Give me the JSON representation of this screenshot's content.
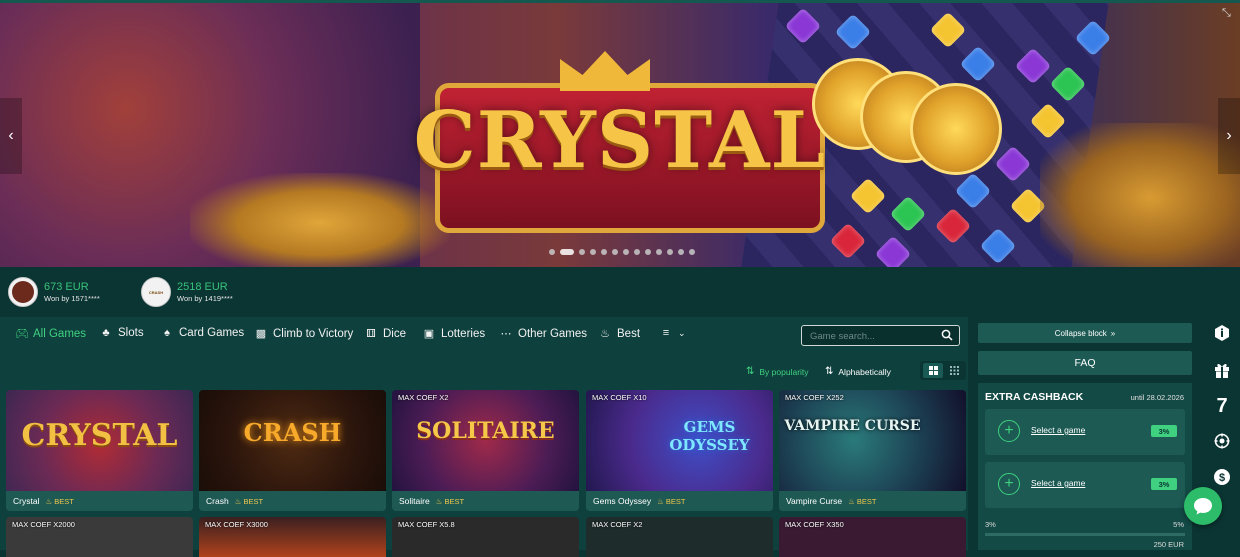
{
  "banner": {
    "title": "CRYSTAL",
    "slides_total": 13,
    "active_slide": 2
  },
  "winners": [
    {
      "amount": "673 EUR",
      "by": "Won by 1571****"
    },
    {
      "amount": "2518 EUR",
      "by": "Won by 1419****",
      "avatar_text": "CRASH"
    }
  ],
  "tabs": [
    {
      "label": "All Games",
      "icon": "gamepad-icon"
    },
    {
      "label": "Slots",
      "icon": "cherries-icon"
    },
    {
      "label": "Card Games",
      "icon": "spade-icon"
    },
    {
      "label": "Climb to Victory",
      "icon": "bars-icon"
    },
    {
      "label": "Dice",
      "icon": "dice-icon"
    },
    {
      "label": "Lotteries",
      "icon": "ticket-icon"
    },
    {
      "label": "Other Games",
      "icon": "dots-icon"
    },
    {
      "label": "Best",
      "icon": "flame-icon"
    }
  ],
  "search": {
    "placeholder": "Game search..."
  },
  "sort": {
    "popularity": "By popularity",
    "alphabetical": "Alphabetically"
  },
  "games": [
    {
      "name": "Crystal",
      "badge": "BEST",
      "coef": "",
      "logo": "CRYSTAL"
    },
    {
      "name": "Crash",
      "badge": "BEST",
      "coef": "",
      "logo": "CRASH"
    },
    {
      "name": "Solitaire",
      "badge": "BEST",
      "coef": "MAX COEF X2",
      "logo": "SOLITAIRE"
    },
    {
      "name": "Gems Odyssey",
      "badge": "BEST",
      "coef": "MAX COEF X10",
      "logo": "GEMS ODYSSEY"
    },
    {
      "name": "Vampire Curse",
      "badge": "BEST",
      "coef": "MAX COEF X252",
      "logo": "VAMPIRE CURSE"
    }
  ],
  "games_row2": [
    {
      "coef": "MAX COEF X2000"
    },
    {
      "coef": "MAX COEF X3000"
    },
    {
      "coef": "MAX COEF X5.8"
    },
    {
      "coef": "MAX COEF X2"
    },
    {
      "coef": "MAX COEF X350"
    }
  ],
  "right": {
    "collapse": "Collapse block",
    "faq": "FAQ",
    "cashback_title": "EXTRA CASHBACK",
    "until": "until 28.02.2026",
    "rows": [
      {
        "label": "Select a game",
        "pct": "3%"
      },
      {
        "label": "Select a game",
        "pct": "3%"
      }
    ],
    "progress_min": "3%",
    "progress_max": "5%",
    "progress_amount": "250 EUR"
  },
  "sidebar": {
    "seven": "7"
  }
}
